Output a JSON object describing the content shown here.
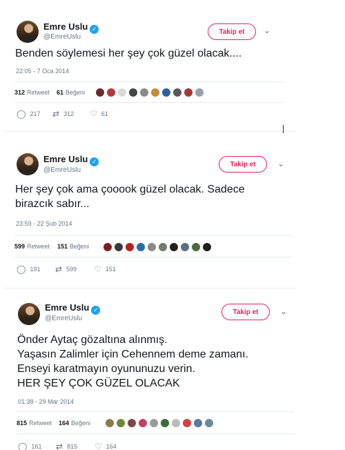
{
  "tweets": [
    {
      "name": "Emre Uslu",
      "handle": "@EmreUslu",
      "follow_label": "Takip et",
      "text_lines": [
        "Benden söylemesi her şey çok güzel olacak...."
      ],
      "timestamp": "22:05 - 7 Oca 2014",
      "retweets_count": "312",
      "retweets_label": "Retweet",
      "likes_count": "61",
      "likes_label": "Beğeni",
      "reply_count": "217",
      "retweet_action_count": "312",
      "like_action_count": "61",
      "liker_colors": [
        "#6b2b2b",
        "#b5383d",
        "#d9d9d9",
        "#444444",
        "#8a8a8a",
        "#c58a3a",
        "#2d5fa8",
        "#5a5a5a",
        "#a33636",
        "#9aa0a6"
      ]
    },
    {
      "name": "Emre Uslu",
      "handle": "@EmreUslu",
      "follow_label": "Takip et",
      "text_lines": [
        "Her şey çok ama çooook güzel olacak. Sadece",
        "birazcık sabır..."
      ],
      "timestamp": "23:59 - 22 Şub 2014",
      "retweets_count": "599",
      "retweets_label": "Retweet",
      "likes_count": "151",
      "likes_label": "Beğeni",
      "reply_count": "191",
      "retweet_action_count": "599",
      "like_action_count": "151",
      "liker_colors": [
        "#7a2020",
        "#3a3a3a",
        "#b22222",
        "#2e6aa3",
        "#8a8a8a",
        "#6f7d6a",
        "#222222",
        "#5b6f86",
        "#4a6a3a",
        "#1e1e1e"
      ]
    },
    {
      "name": "Emre Uslu",
      "handle": "@EmreUslu",
      "follow_label": "Takip et",
      "text_lines": [
        "Önder Aytaç gözaltına alınmış.",
        "Yaşasın Zalimler için Cehennem deme zamanı.",
        "Enseyi karatmayın oyununuzu verin.",
        "HER ŞEY ÇOK GÜZEL OLACAK"
      ],
      "timestamp": "01:38 - 29 Mar 2014",
      "retweets_count": "815",
      "retweets_label": "Retweet",
      "likes_count": "164",
      "likes_label": "Beğeni",
      "reply_count": "161",
      "retweet_action_count": "815",
      "like_action_count": "164",
      "liker_colors": [
        "#8a7a4a",
        "#6b8a3a",
        "#7a4a4a",
        "#c04060",
        "#9a9a9a",
        "#3a6a3a",
        "#bbbbbb",
        "#d04040",
        "#5a7aa0",
        "#6a8a9a"
      ]
    }
  ]
}
